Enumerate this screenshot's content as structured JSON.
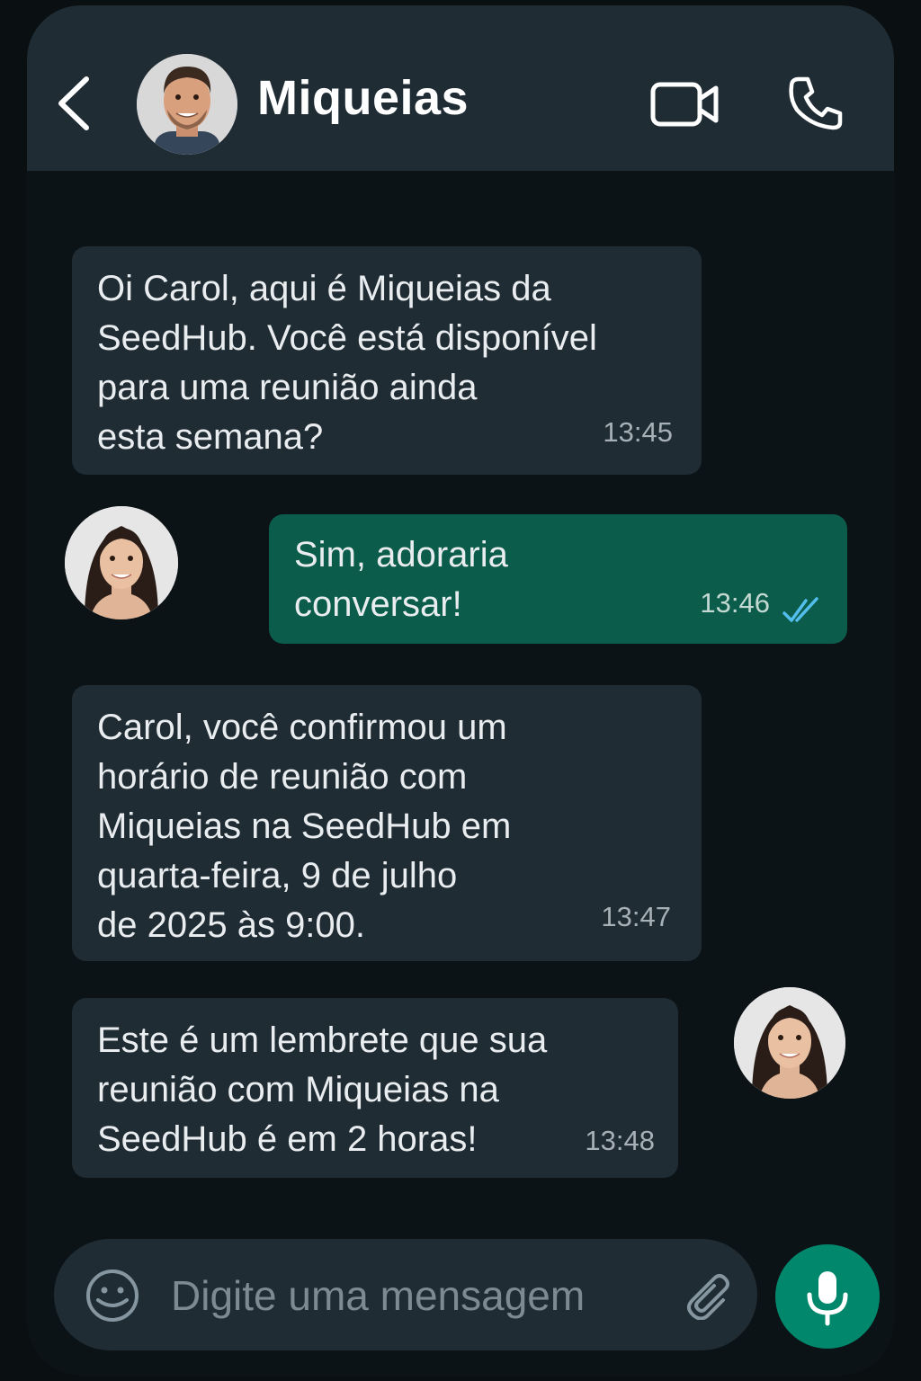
{
  "header": {
    "contact_name": "Miqueias",
    "back_icon": "chevron-left-icon",
    "video_icon": "video-camera-icon",
    "call_icon": "phone-icon"
  },
  "messages": [
    {
      "direction": "incoming",
      "text": "Oi Carol, aqui é Miqueias da\nSeedHub. Você está disponível\npara uma reunião ainda\nesta semana?",
      "time": "13:45"
    },
    {
      "direction": "outgoing",
      "text": "Sim, adoraria\nconversar!",
      "time": "13:46",
      "status": "read",
      "status_icon": "double-check-icon"
    },
    {
      "direction": "incoming",
      "text": "Carol, você confirmou um\nhorário de reunião com\nMiqueias na SeedHub em\nquarta-feira, 9 de julho\nde 2025 às 9:00.",
      "time": "13:47"
    },
    {
      "direction": "incoming",
      "text": "Este é um lembrete que sua\nreunião com Miqueias na\nSeedHub é em 2 horas!",
      "time": "13:48"
    }
  ],
  "composer": {
    "placeholder": "Digite uma mensagem",
    "emoji_icon": "emoji-icon",
    "attach_icon": "paperclip-icon",
    "mic_icon": "microphone-icon"
  },
  "colors": {
    "background": "#0c1317",
    "header": "#1f2c34",
    "incoming_bubble": "#1f2c34",
    "outgoing_bubble": "#0b5c4a",
    "accent": "#00876c",
    "read_check": "#53bdeb"
  }
}
